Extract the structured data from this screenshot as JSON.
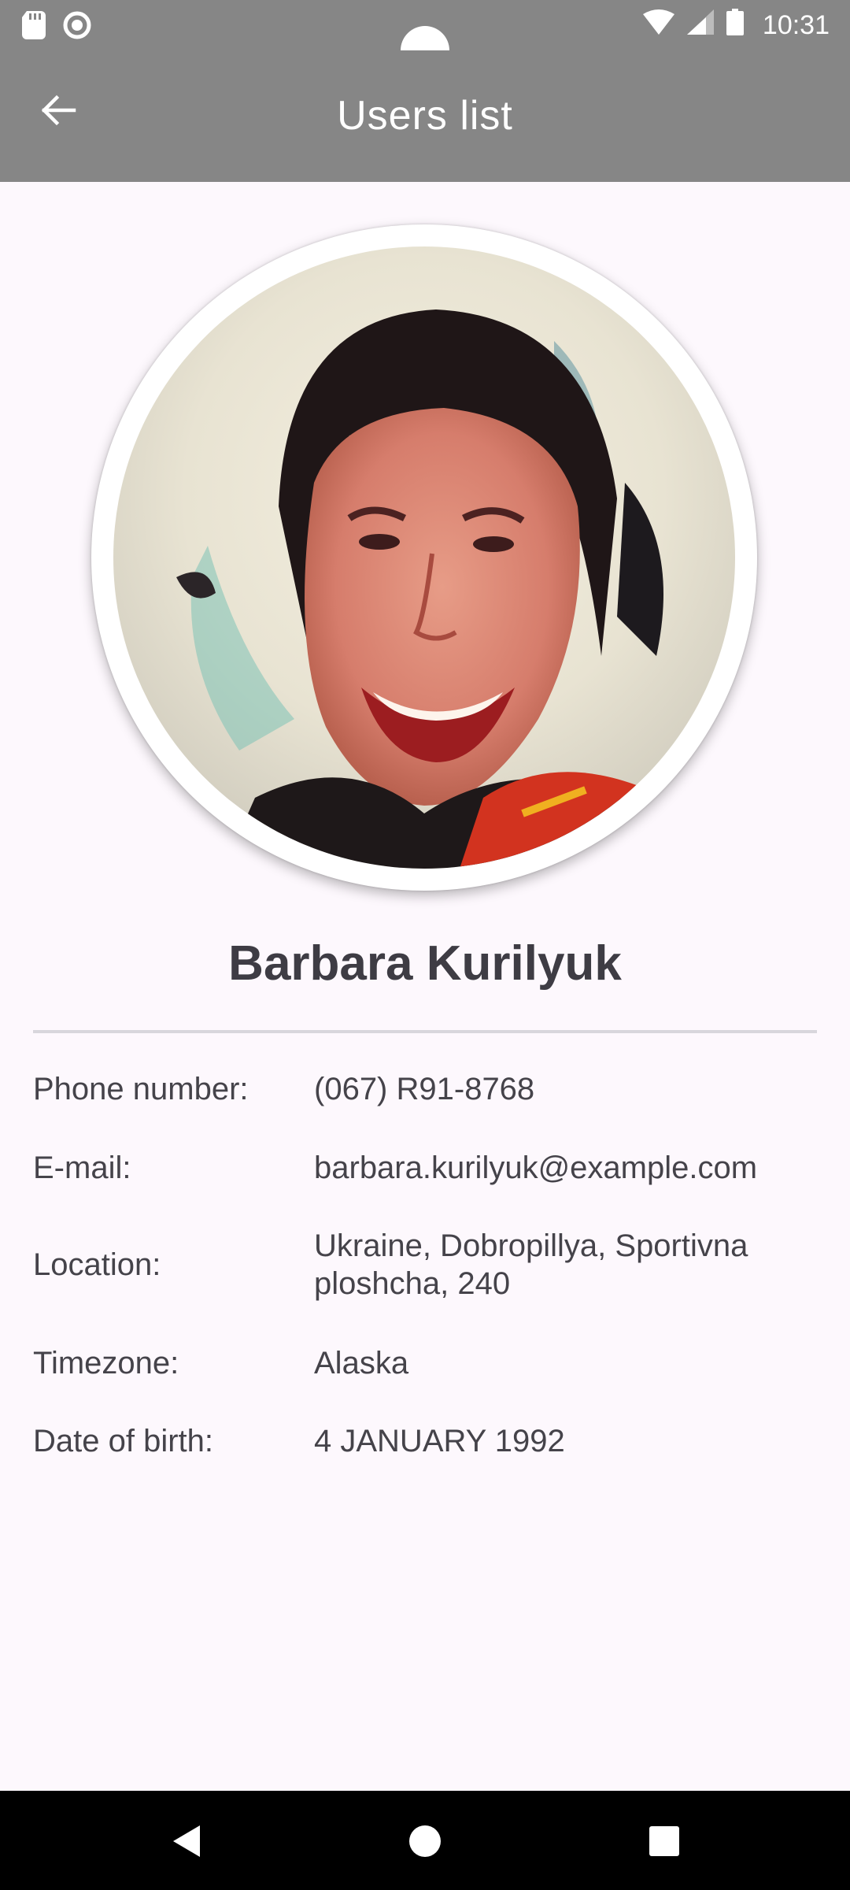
{
  "status_bar": {
    "time": "10:31",
    "icons": [
      "sd-card-icon",
      "record-icon",
      "wifi-icon",
      "cellular-signal-icon",
      "battery-icon"
    ]
  },
  "app_bar": {
    "title": "Users list",
    "back_icon": "arrow-back-icon"
  },
  "profile": {
    "name": "Barbara Kurilyuk",
    "avatar_icon": "user-photo"
  },
  "details": [
    {
      "label": "Phone number:",
      "value": "(067) R91-8768"
    },
    {
      "label": "E-mail:",
      "value": "barbara.kurilyuk@example.com"
    },
    {
      "label": "Location:",
      "value": "Ukraine, Dobropillya, Sportivna ploshcha, 240"
    },
    {
      "label": "Timezone:",
      "value": "Alaska"
    },
    {
      "label": "Date of birth:",
      "value": "4 JANUARY 1992"
    }
  ],
  "nav_bar": {
    "icons": [
      "back-triangle-icon",
      "home-circle-icon",
      "recents-square-icon"
    ]
  },
  "colors": {
    "app_bar": "#868686",
    "background": "#fdf8fd",
    "text": "#3e3c44",
    "divider": "#d8d6dc",
    "nav_bar": "#000000"
  }
}
